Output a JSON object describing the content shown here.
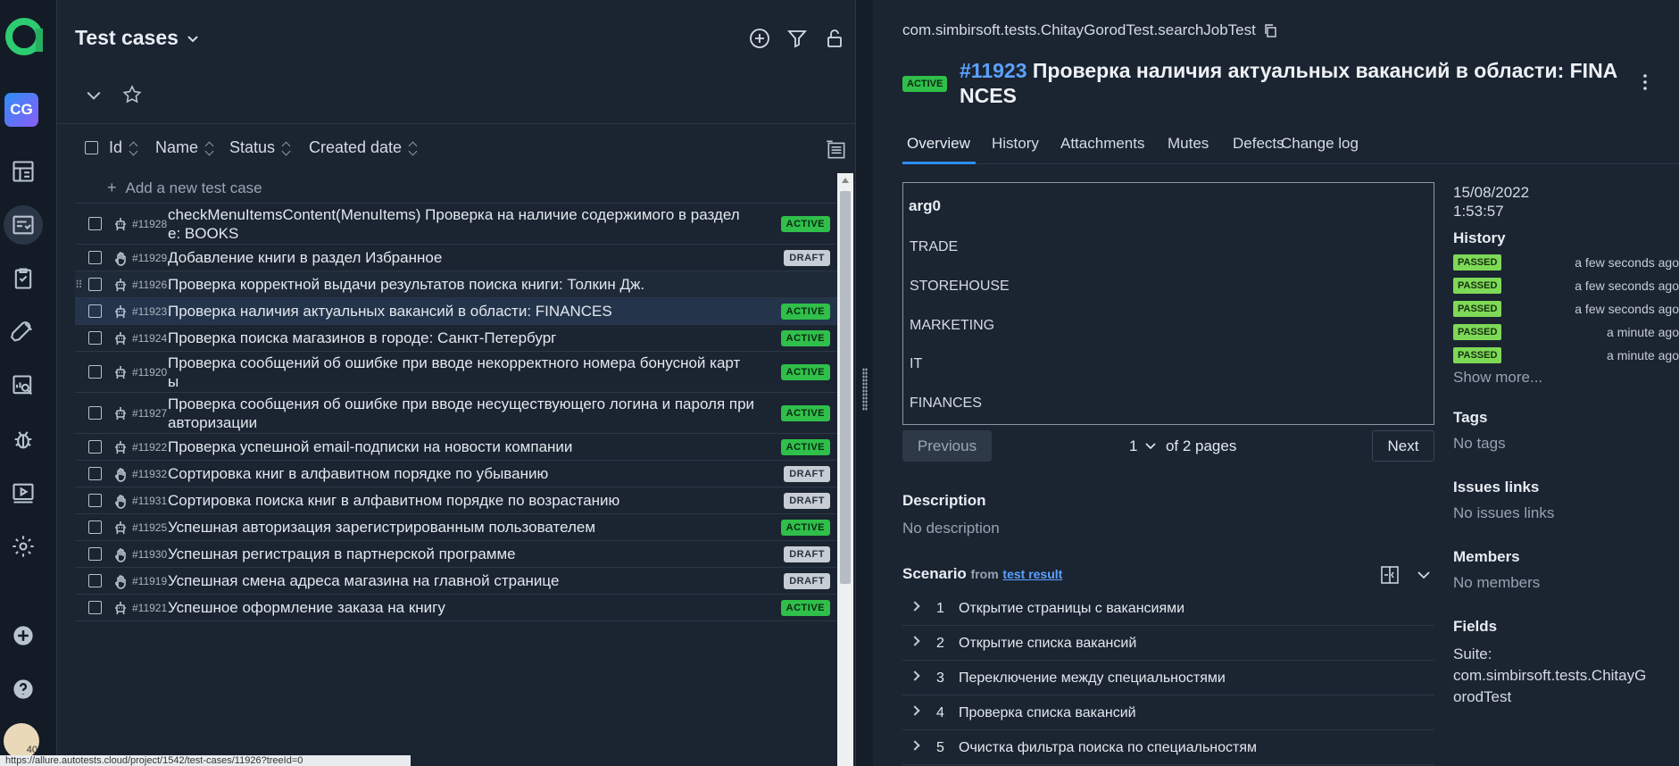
{
  "left": {
    "title": "Test cases",
    "columns": {
      "id": "Id",
      "name": "Name",
      "status": "Status",
      "created": "Created date"
    },
    "add_label": "Add a new test case",
    "rows": [
      {
        "id": "#11928",
        "name": "checkMenuItemsContent(MenuItems) Проверка на наличие содержимого в раздел\nе: BOOKS",
        "status": "ACTIVE",
        "kind": "auto"
      },
      {
        "id": "#11929",
        "name": "Добавление книги в раздел Избранное",
        "status": "DRAFT",
        "kind": "manual"
      },
      {
        "id": "#11926",
        "name": "Проверка корректной выдачи результатов поиска книги: Толкин Дж.",
        "status": "",
        "kind": "auto"
      },
      {
        "id": "#11923",
        "name": "Проверка наличия актуальных вакансий в области: FINANCES",
        "status": "ACTIVE",
        "kind": "auto"
      },
      {
        "id": "#11924",
        "name": "Проверка поиска магазинов в городе: Санкт-Петербург",
        "status": "ACTIVE",
        "kind": "auto"
      },
      {
        "id": "#11920",
        "name": "Проверка сообщений об ошибке при вводе некорректного номера бонусной карт\nы",
        "status": "ACTIVE",
        "kind": "auto"
      },
      {
        "id": "#11927",
        "name": "Проверка сообщения об ошибке при вводе несуществующего логина и пароля при\nавторизации",
        "status": "ACTIVE",
        "kind": "auto"
      },
      {
        "id": "#11922",
        "name": "Проверка успешной email-подписки на новости компании",
        "status": "ACTIVE",
        "kind": "auto"
      },
      {
        "id": "#11932",
        "name": "Сортировка книг в алфавитном порядке по убыванию",
        "status": "DRAFT",
        "kind": "manual"
      },
      {
        "id": "#11931",
        "name": "Сортировка поиска книг в алфавитном порядке по возрастанию",
        "status": "DRAFT",
        "kind": "manual"
      },
      {
        "id": "#11925",
        "name": "Успешная авторизация зарегистрированным пользователем",
        "status": "ACTIVE",
        "kind": "auto"
      },
      {
        "id": "#11930",
        "name": "Успешная регистрация в партнерской программе",
        "status": "DRAFT",
        "kind": "manual"
      },
      {
        "id": "#11919",
        "name": "Успешная смена адреса магазина на главной странице",
        "status": "DRAFT",
        "kind": "manual"
      },
      {
        "id": "#11921",
        "name": "Успешное оформление заказа на книгу",
        "status": "ACTIVE",
        "kind": "auto"
      }
    ],
    "status_url": "https://allure.autotests.cloud/project/1542/test-cases/11926?treeId=0"
  },
  "rail": {
    "avatar_initials": "CG",
    "user_badge": "40"
  },
  "detail": {
    "path": "com.simbirsoft.tests.ChitayGorodTest.searchJobTest",
    "status": "ACTIVE",
    "number": "#11923",
    "title_line1": "Проверка наличия актуальных вакансий в области: FINA",
    "title_line2": "NCES",
    "tabs": [
      "Overview",
      "History",
      "Attachments",
      "Mutes",
      "Defects",
      "Change log"
    ],
    "params_header": "arg0",
    "params": [
      "TRADE",
      "STOREHOUSE",
      "MARKETING",
      "IT",
      "FINANCES"
    ],
    "pager": {
      "prev": "Previous",
      "page": "1",
      "of": "of 2 pages",
      "next": "Next"
    },
    "description_h": "Description",
    "description_v": "No description",
    "scenario_h": "Scenario",
    "scenario_from": "from",
    "scenario_link": "test result",
    "steps": [
      {
        "n": "1",
        "t": "Открытие страницы с вакансиями"
      },
      {
        "n": "2",
        "t": "Открытие списка вакансий"
      },
      {
        "n": "3",
        "t": "Переключение между специальностями"
      },
      {
        "n": "4",
        "t": "Проверка списка вакансий"
      },
      {
        "n": "5",
        "t": "Очистка фильтра поиска по специальностям"
      }
    ],
    "side": {
      "date": "15/08/2022",
      "time": "1:53:57",
      "history_h": "History",
      "history": [
        {
          "s": "PASSED",
          "ago": "a few seconds ago"
        },
        {
          "s": "PASSED",
          "ago": "a few seconds ago"
        },
        {
          "s": "PASSED",
          "ago": "a few seconds ago"
        },
        {
          "s": "PASSED",
          "ago": "a minute ago"
        },
        {
          "s": "PASSED",
          "ago": "a minute ago"
        }
      ],
      "show_more": "Show more...",
      "tags_h": "Tags",
      "tags_v": "No tags",
      "issues_h": "Issues links",
      "issues_v": "No issues links",
      "members_h": "Members",
      "members_v": "No members",
      "fields_h": "Fields",
      "suite_label": "Suite:",
      "suite_value": "com.simbirsoft.tests.ChitayG\norodTest"
    }
  },
  "colors": {
    "active": "#2fbf4a",
    "draft": "#c6cdd5",
    "passed": "#7ed957",
    "link": "#5aa2ff",
    "bg": "#1b2431"
  }
}
